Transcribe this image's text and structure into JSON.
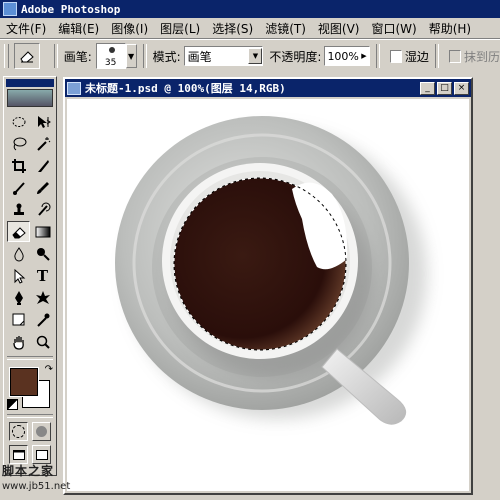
{
  "app": {
    "title": "Adobe Photoshop"
  },
  "menu": [
    "文件(F)",
    "编辑(E)",
    "图像(I)",
    "图层(L)",
    "选择(S)",
    "滤镜(T)",
    "视图(V)",
    "窗口(W)",
    "帮助(H)"
  ],
  "options": {
    "brush_label": "画笔:",
    "brush_size": "35",
    "mode_label": "模式:",
    "mode_value": "画笔",
    "opacity_label": "不透明度:",
    "opacity_value": "100%",
    "wet_edges_label": "湿边",
    "erase_history_label": "抹到历"
  },
  "colors": {
    "foreground": "#5a3220",
    "background": "#ffffff",
    "titlebar": "#0a246a"
  },
  "document": {
    "title": "未标题-1.psd @ 100%(图层 14,RGB)",
    "minimize": "_",
    "maximize": "□",
    "close": "×"
  },
  "watermark": {
    "line1": "脚本之家",
    "line2": "www.jb51.net"
  }
}
